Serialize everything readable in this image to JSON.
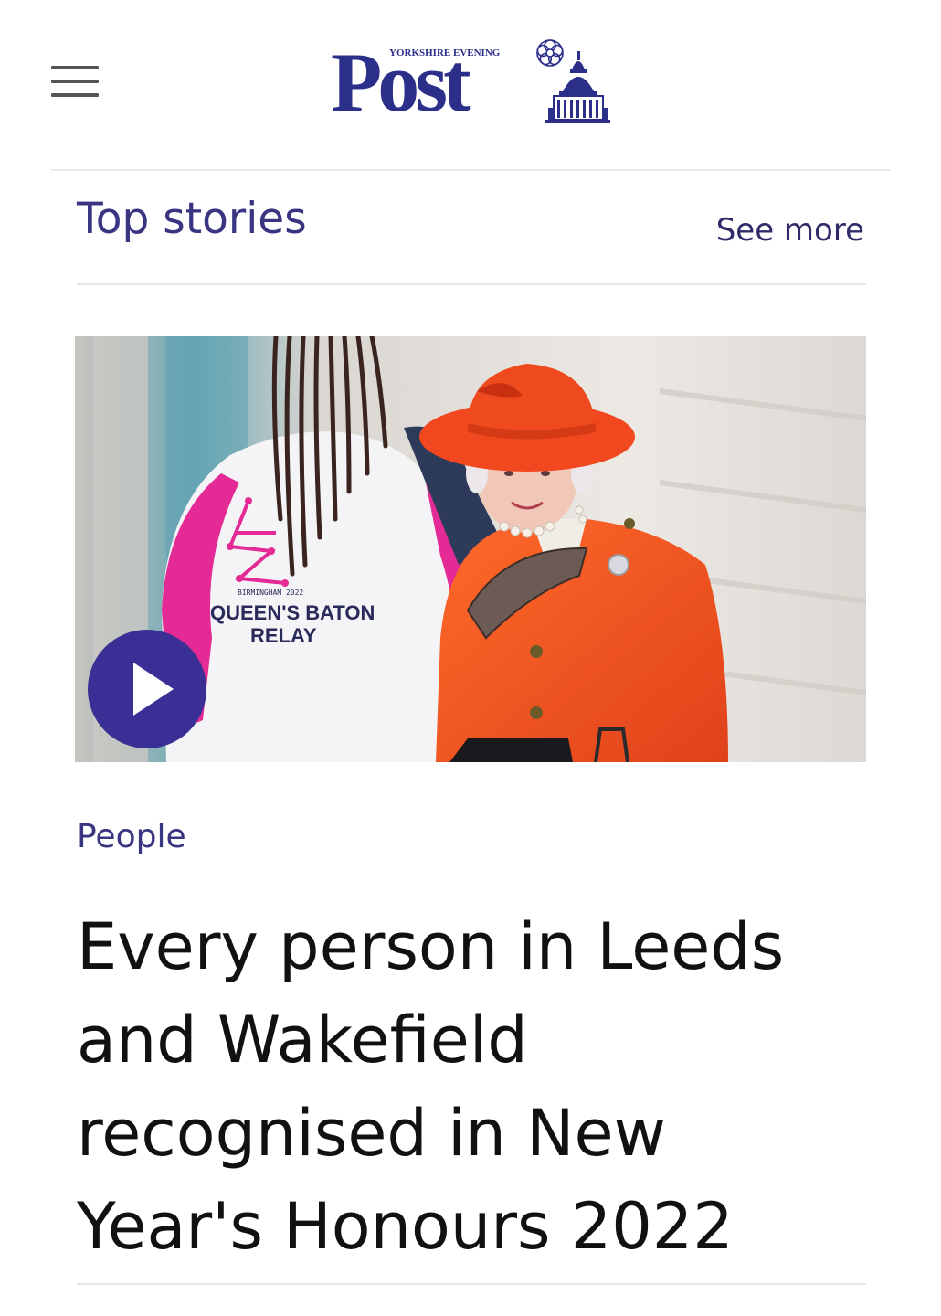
{
  "header": {
    "logo_small": "YORKSHIRE EVENING",
    "logo_main": "Post",
    "brand_color": "#2b2f8a"
  },
  "section": {
    "title": "Top stories",
    "see_more": "See more",
    "accent_color": "#3a3583"
  },
  "story": {
    "image_description": "photo",
    "play_icon": "play-icon",
    "category": "People",
    "headline": "Every person in Leeds and Wakefield recognised in New Year's Honours 2022",
    "image_text": {
      "line1": "BIRMINGHAM 2022",
      "line2": "QUEEN'S BATON",
      "line3": "RELAY"
    }
  },
  "icons": {
    "menu": "hamburger-menu-icon",
    "play": "play-icon"
  }
}
